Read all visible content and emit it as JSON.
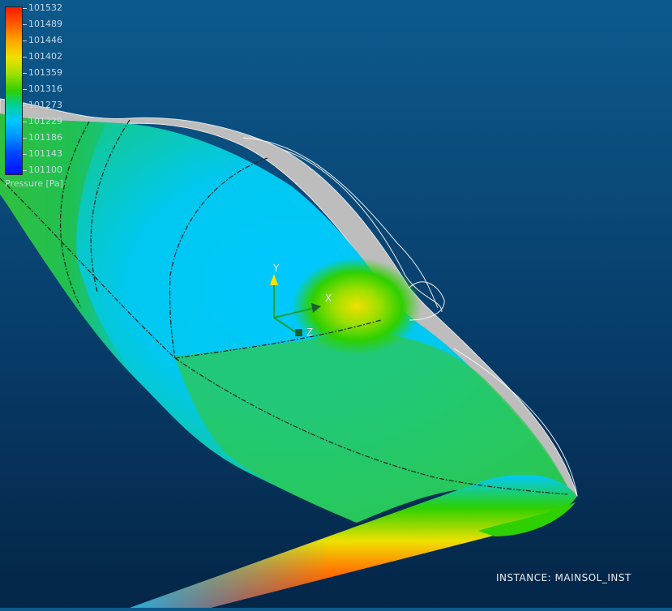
{
  "legend": {
    "title": "Pressure [Pa]",
    "ticks": [
      "101532",
      "101489",
      "101446",
      "101402",
      "101359",
      "101316",
      "101273",
      "101229",
      "101186",
      "101143",
      "101100"
    ],
    "colors": {
      "max": "#ff1a00",
      "mid": "#2ed000",
      "min": "#0010ff"
    }
  },
  "triad": {
    "x_label": "X",
    "y_label": "Y",
    "z_label": "Z"
  },
  "instance": {
    "label": "INSTANCE: MAINSOL_INST"
  },
  "background": {
    "top": "#0c5a8c",
    "bottom": "#042649"
  }
}
